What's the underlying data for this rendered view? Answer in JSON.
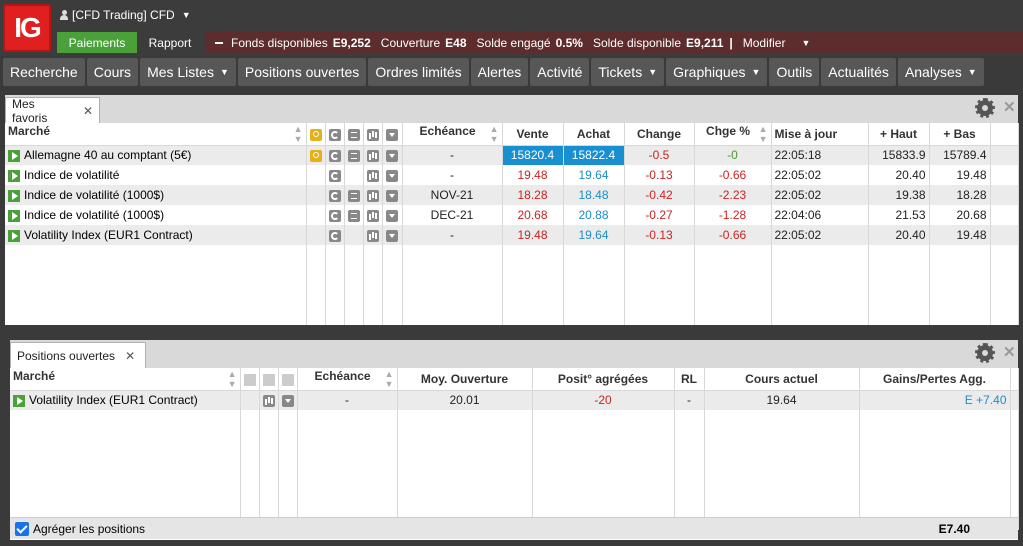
{
  "app": {
    "logo_text": "IG",
    "account_label": "[CFD Trading] CFD",
    "paiements_label": "Paiements",
    "rapport_label": "Rapport",
    "funds": {
      "fonds_label": "Fonds disponibles",
      "fonds_value": "E9,252",
      "couverture_label": "Couverture",
      "couverture_value": "E48",
      "solde_engage_label": "Solde engagé",
      "solde_engage_value": "0.5%",
      "solde_dispo_label": "Solde disponible",
      "solde_dispo_value": "E9,211",
      "separator": "|",
      "modifier_label": "Modifier"
    }
  },
  "nav": [
    {
      "label": "Recherche",
      "dropdown": false
    },
    {
      "label": "Cours",
      "dropdown": false
    },
    {
      "label": "Mes Listes",
      "dropdown": true
    },
    {
      "label": "Positions ouvertes",
      "dropdown": false
    },
    {
      "label": "Ordres limités",
      "dropdown": false
    },
    {
      "label": "Alertes",
      "dropdown": false
    },
    {
      "label": "Activité",
      "dropdown": false
    },
    {
      "label": "Tickets",
      "dropdown": true
    },
    {
      "label": "Graphiques",
      "dropdown": true
    },
    {
      "label": "Outils",
      "dropdown": false
    },
    {
      "label": "Actualités",
      "dropdown": false
    },
    {
      "label": "Analyses",
      "dropdown": true
    }
  ],
  "favoris": {
    "tab_label": "Mes favoris",
    "columns": {
      "marche": "Marché",
      "echeance": "Echéance",
      "vente": "Vente",
      "achat": "Achat",
      "change": "Change",
      "chge_pct": "Chge %",
      "mise_a_jour": "Mise à jour",
      "haut": "+ Haut",
      "bas": "+ Bas"
    },
    "rows": [
      {
        "marche": "Allemagne 40 au comptant (5€)",
        "echeance": "-",
        "vente": "15820.4",
        "achat": "15822.4",
        "change": "-0.5",
        "chge_pct": "-0",
        "mise_a_jour": "22:05:18",
        "haut": "15833.9",
        "bas": "15789.4"
      },
      {
        "marche": "Indice de volatilité",
        "echeance": "-",
        "vente": "19.48",
        "achat": "19.64",
        "change": "-0.13",
        "chge_pct": "-0.66",
        "mise_a_jour": "22:05:02",
        "haut": "20.40",
        "bas": "19.48"
      },
      {
        "marche": "Indice de volatilité (1000$)",
        "echeance": "NOV-21",
        "vente": "18.28",
        "achat": "18.48",
        "change": "-0.42",
        "chge_pct": "-2.23",
        "mise_a_jour": "22:05:02",
        "haut": "19.38",
        "bas": "18.28"
      },
      {
        "marche": "Indice de volatilité (1000$)",
        "echeance": "DEC-21",
        "vente": "20.68",
        "achat": "20.88",
        "change": "-0.27",
        "chge_pct": "-1.28",
        "mise_a_jour": "22:04:06",
        "haut": "21.53",
        "bas": "20.68"
      },
      {
        "marche": "Volatility Index (EUR1 Contract)",
        "echeance": "-",
        "vente": "19.48",
        "achat": "19.64",
        "change": "-0.13",
        "chge_pct": "-0.66",
        "mise_a_jour": "22:05:02",
        "haut": "20.40",
        "bas": "19.48"
      }
    ]
  },
  "positions": {
    "tab_label": "Positions ouvertes",
    "columns": {
      "marche": "Marché",
      "echeance": "Echéance",
      "moy_ouverture": "Moy. Ouverture",
      "posit_agregees": "Posit° agrégées",
      "rl": "RL",
      "cours_actuel": "Cours actuel",
      "gains_pertes": "Gains/Pertes Agg."
    },
    "rows": [
      {
        "marche": "Volatility Index (EUR1 Contract)",
        "echeance": "-",
        "moy_ouverture": "20.01",
        "posit_agregees": "-20",
        "rl": "-",
        "cours_actuel": "19.64",
        "gains_pertes": "E +7.40"
      }
    ],
    "aggregate_label": "Agréger les positions",
    "total": "E7.40"
  },
  "colors": {
    "accent_green": "#4ba139",
    "funds_bar": "#5d2c2c",
    "logo_red": "#e0201f",
    "highlight_blue": "#1a8fd0",
    "sell_red": "#cc2222",
    "buy_blue": "#1a8fc9"
  }
}
